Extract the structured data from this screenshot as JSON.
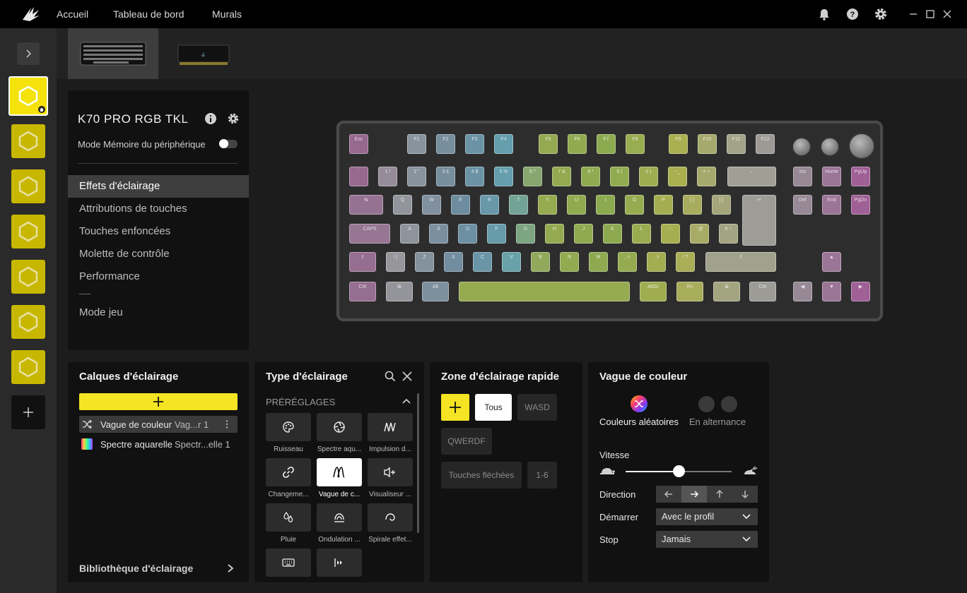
{
  "nav": {
    "home": "Accueil",
    "dashboard": "Tableau de bord",
    "murals": "Murals"
  },
  "device": {
    "name": "K70 PRO RGB TKL",
    "memory_mode_label": "Mode Mémoire du périphérique",
    "memory_mode_on": false,
    "menu": [
      "Effets d'éclairage",
      "Attributions de touches",
      "Touches enfoncées",
      "Molette de contrôle",
      "Performance",
      "Mode jeu"
    ],
    "menu_selected": "Effets d'éclairage"
  },
  "layers": {
    "title": "Calques d'éclairage",
    "items": [
      {
        "name": "Vague de couleur",
        "preset": "Vag...r 1",
        "icon": "shuffle-icon"
      },
      {
        "name": "Spectre aquarelle",
        "preset": "Spectr...elle 1",
        "icon": "spectrum-swatch-icon"
      }
    ],
    "library": "Bibliothèque d'éclairage"
  },
  "lighting_type": {
    "title": "Type d'éclairage",
    "section": "PRÉRÉGLAGES",
    "presets": [
      {
        "label": "Ruisseau",
        "icon": "palette-icon"
      },
      {
        "label": "Spectre aqu...",
        "icon": "aperture-icon"
      },
      {
        "label": "Impulsion d...",
        "icon": "pulse-wave-icon"
      },
      {
        "label": "Changeme...",
        "icon": "link-icon"
      },
      {
        "label": "Vague de c...",
        "icon": "wave-icon",
        "selected": true
      },
      {
        "label": "Visualiseur ...",
        "icon": "speaker-icon"
      },
      {
        "label": "Pluie",
        "icon": "rain-drops-icon"
      },
      {
        "label": "Ondulation ...",
        "icon": "ripple-icon"
      },
      {
        "label": "Spirale effet...",
        "icon": "spiral-icon"
      },
      {
        "label": "",
        "icon": "keyboard-icon"
      },
      {
        "label": "",
        "icon": "sequence-icon"
      }
    ]
  },
  "quick_zone": {
    "title": "Zone d'éclairage rapide",
    "buttons": [
      "Tous",
      "WASD",
      "QWERDF",
      "Touches fléchées",
      "1-6"
    ],
    "selected": "Tous"
  },
  "color_wave": {
    "title": "Vague de couleur",
    "mode_random": "Couleurs aléatoires",
    "mode_alternate": "En alternance",
    "speed_label": "Vitesse",
    "speed_fraction": 0.5,
    "direction_label": "Direction",
    "direction_selected": "right",
    "start_label": "Démarrer",
    "start_value": "Avec le profil",
    "stop_label": "Stop",
    "stop_value": "Jamais"
  },
  "colors": {
    "accent": "#f4e423",
    "profile_tile": "#c8b700",
    "panel": "#111111"
  },
  "keyboard": {
    "row0": [
      "Esc",
      "",
      "F1",
      "F2",
      "F3",
      "F4",
      "F5",
      "F6",
      "F7",
      "F8",
      "F9",
      "F10",
      "F11",
      "F12"
    ],
    "row1": [
      "`",
      "1 !",
      "2 \"",
      "3 £",
      "4 $",
      "5 %",
      "6 ^",
      "7 &",
      "8 *",
      "9 (",
      "0 )",
      "- _",
      "= +",
      "←",
      "Ins",
      "Home",
      "PgUp"
    ],
    "row2": [
      "⇆",
      "Q",
      "W",
      "E",
      "R",
      "T",
      "Y",
      "U",
      "I",
      "O",
      "P",
      "[ {",
      "] }",
      "↵",
      "Del",
      "End",
      "PgDn"
    ],
    "row3": [
      "CAPS",
      "A",
      "S",
      "D",
      "F",
      "G",
      "H",
      "J",
      "K",
      "L",
      "; :",
      "' @",
      "# ~"
    ],
    "row4": [
      "⇧",
      "\\ |",
      "Z",
      "X",
      "C",
      "V",
      "B",
      "N",
      "M",
      ", <",
      ". >",
      "/ ?",
      "⇧",
      "▲"
    ],
    "row5": [
      "Ctrl",
      "⊞",
      "Alt",
      "",
      "AltGr",
      "Fn",
      "≣",
      "Ctrl",
      "◀",
      "▼",
      "▶"
    ]
  }
}
